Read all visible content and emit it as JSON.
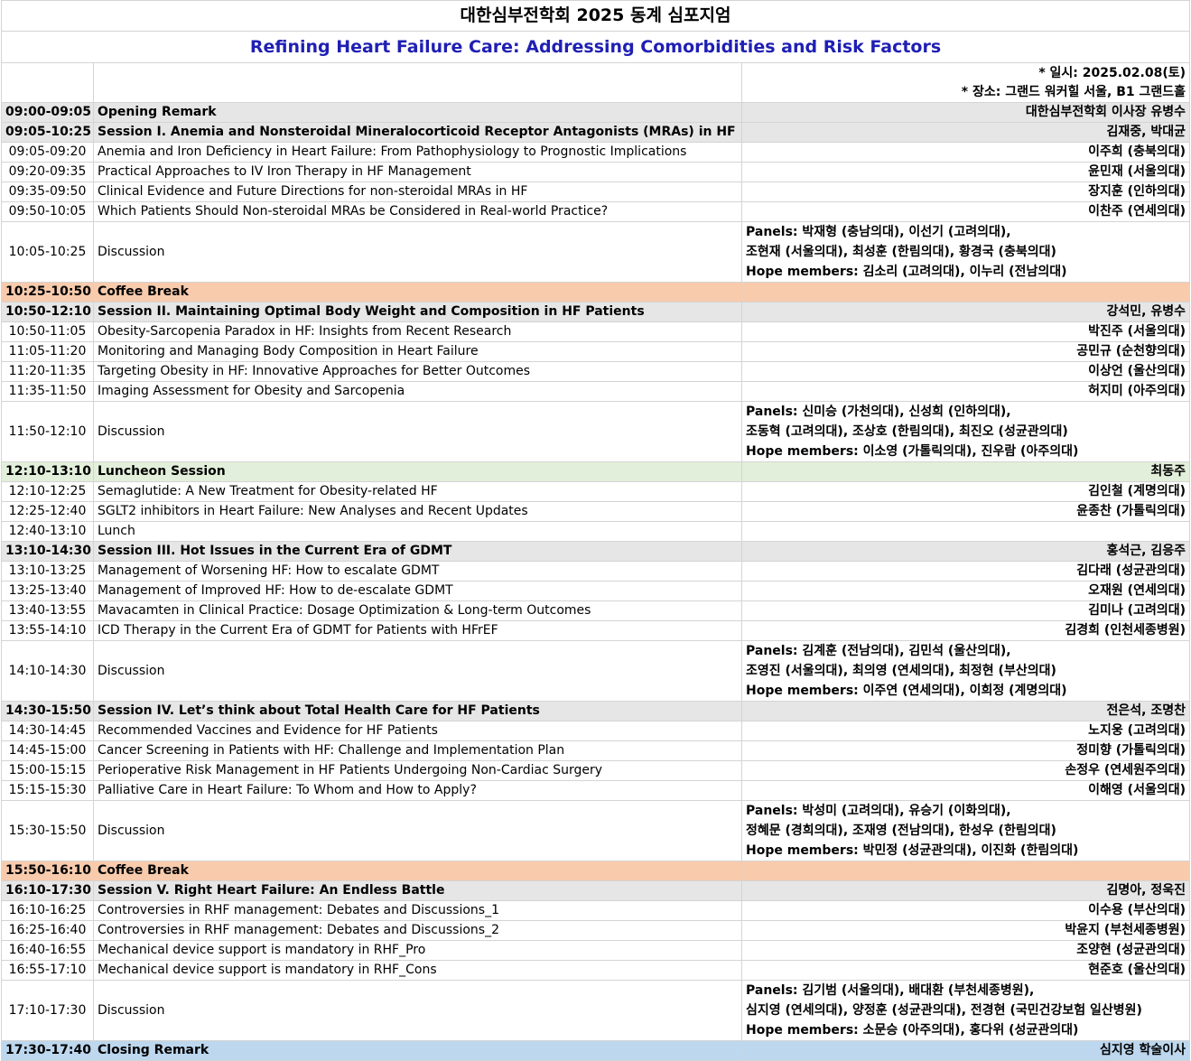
{
  "title": "대한심부전학회 2025 동계 심포지엄",
  "subtitle": "Refining Heart Failure Care: Addressing Comorbidities and Risk Factors",
  "info": {
    "date": "* 일시: 2025.02.08(토)",
    "venue": "* 장소: 그랜드 워커힐 서울, B1 그랜드홀"
  },
  "rows": [
    {
      "type": "section",
      "bg": "gray",
      "time": "09:00-09:05",
      "title": "Opening Remark",
      "speaker": "대한심부전학회 이사장 유병수"
    },
    {
      "type": "section",
      "bg": "gray",
      "time": "09:05-10:25",
      "title": "Session I. Anemia and Nonsteroidal Mineralocorticoid Receptor Antagonists (MRAs) in HF",
      "speaker": "김재중, 박대균"
    },
    {
      "type": "talk",
      "time": "09:05-09:20",
      "title": "Anemia and Iron Deficiency in Heart Failure: From Pathophysiology to Prognostic Implications",
      "speaker": "이주희 (충북의대)"
    },
    {
      "type": "talk",
      "time": "09:20-09:35",
      "title": "Practical Approaches to IV Iron Therapy in HF Management",
      "speaker": "윤민재 (서울의대)"
    },
    {
      "type": "talk",
      "time": "09:35-09:50",
      "title": "Clinical Evidence and Future Directions for non-steroidal MRAs in HF",
      "speaker": "장지훈 (인하의대)"
    },
    {
      "type": "talk",
      "time": "09:50-10:05",
      "title": "Which Patients Should Non-steroidal MRAs be Considered in Real-world Practice?",
      "speaker": "이찬주 (연세의대)"
    },
    {
      "type": "discussion",
      "time": "10:05-10:25",
      "title": "Discussion",
      "lines": [
        "Panels: 박재형 (충남의대), 이선기 (고려의대),",
        "조현재 (서울의대), 최성훈 (한림의대), 황경국 (충북의대)",
        "Hope members: 김소리 (고려의대), 이누리 (전남의대)"
      ]
    },
    {
      "type": "section",
      "bg": "peach",
      "time": "10:25-10:50",
      "title": "Coffee Break",
      "speaker": ""
    },
    {
      "type": "section",
      "bg": "gray",
      "time": "10:50-12:10",
      "title": "Session II. Maintaining Optimal Body Weight and Composition in HF Patients",
      "speaker": "강석민, 유병수"
    },
    {
      "type": "talk",
      "time": "10:50-11:05",
      "title": "Obesity-Sarcopenia Paradox in HF: Insights from Recent Research",
      "speaker": "박진주 (서울의대)"
    },
    {
      "type": "talk",
      "time": "11:05-11:20",
      "title": "Monitoring and Managing Body Composition in Heart Failure",
      "speaker": "공민규 (순천향의대)"
    },
    {
      "type": "talk",
      "time": "11:20-11:35",
      "title": "Targeting Obesity in HF: Innovative Approaches for Better Outcomes",
      "speaker": "이상언 (울산의대)"
    },
    {
      "type": "talk",
      "time": "11:35-11:50",
      "title": "Imaging Assessment for Obesity and Sarcopenia",
      "speaker": "허지미 (아주의대)"
    },
    {
      "type": "discussion",
      "time": "11:50-12:10",
      "title": "Discussion",
      "lines": [
        "Panels: 신미승 (가천의대), 신성희 (인하의대),",
        "조동혁 (고려의대), 조상호 (한림의대), 최진오 (성균관의대)",
        "Hope members: 이소영 (가톨릭의대), 진우람 (아주의대)"
      ]
    },
    {
      "type": "section",
      "bg": "green",
      "time": "12:10-13:10",
      "title": "Luncheon Session",
      "speaker": "최동주"
    },
    {
      "type": "talk",
      "time": "12:10-12:25",
      "title": "Semaglutide: A New Treatment for Obesity-related HF",
      "speaker": "김인철 (계명의대)"
    },
    {
      "type": "talk",
      "time": "12:25-12:40",
      "title": "SGLT2 inhibitors in Heart Failure: New Analyses and Recent Updates",
      "speaker": "윤종찬 (가톨릭의대)"
    },
    {
      "type": "talk",
      "time": "12:40-13:10",
      "title": "Lunch",
      "speaker": ""
    },
    {
      "type": "section",
      "bg": "gray",
      "time": "13:10-14:30",
      "title": "Session III. Hot Issues in the Current Era of GDMT",
      "speaker": "홍석근, 김응주"
    },
    {
      "type": "talk",
      "time": "13:10-13:25",
      "title": "Management of Worsening HF: How to escalate GDMT",
      "speaker": "김다래 (성균관의대)"
    },
    {
      "type": "talk",
      "time": "13:25-13:40",
      "title": "Management of Improved HF: How to de-escalate GDMT",
      "speaker": "오재원 (연세의대)"
    },
    {
      "type": "talk",
      "time": "13:40-13:55",
      "title": "Mavacamten in Clinical Practice: Dosage Optimization & Long-term Outcomes",
      "speaker": "김미나 (고려의대)"
    },
    {
      "type": "talk",
      "time": "13:55-14:10",
      "title": "ICD Therapy in the Current Era of GDMT for Patients with HFrEF",
      "speaker": "김경희 (인천세종병원)"
    },
    {
      "type": "discussion",
      "time": "14:10-14:30",
      "title": "Discussion",
      "lines": [
        "Panels: 김계훈 (전남의대), 김민석 (울산의대),",
        "조영진 (서울의대), 최의영 (연세의대), 최정현 (부산의대)",
        "Hope members: 이주연 (연세의대), 이희정 (계명의대)"
      ]
    },
    {
      "type": "section",
      "bg": "gray",
      "time": "14:30-15:50",
      "title": "Session IV. Let’s think about Total Health Care for HF Patients",
      "speaker": "전은석, 조명찬"
    },
    {
      "type": "talk",
      "time": "14:30-14:45",
      "title": "Recommended Vaccines and Evidence for HF Patients",
      "speaker": "노지웅 (고려의대)"
    },
    {
      "type": "talk",
      "time": "14:45-15:00",
      "title": "Cancer Screening in Patients with HF: Challenge and Implementation Plan",
      "speaker": "정미향 (가톨릭의대)"
    },
    {
      "type": "talk",
      "time": "15:00-15:15",
      "title": "Perioperative Risk Management in HF Patients Undergoing Non-Cardiac Surgery",
      "speaker": "손정우 (연세원주의대)"
    },
    {
      "type": "talk",
      "time": "15:15-15:30",
      "title": "Palliative Care in Heart Failure: To Whom and How to Apply?",
      "speaker": "이해영 (서울의대)"
    },
    {
      "type": "discussion",
      "time": "15:30-15:50",
      "title": "Discussion",
      "lines": [
        "Panels: 박성미 (고려의대), 유승기 (이화의대),",
        "정혜문 (경희의대), 조재영 (전남의대), 한성우 (한림의대)",
        "Hope members: 박민정 (성균관의대), 이진화 (한림의대)"
      ]
    },
    {
      "type": "section",
      "bg": "peach",
      "time": "15:50-16:10",
      "title": "Coffee Break",
      "speaker": ""
    },
    {
      "type": "section",
      "bg": "gray",
      "time": "16:10-17:30",
      "title": "Session V. Right Heart Failure: An Endless Battle",
      "speaker": "김명아, 정욱진"
    },
    {
      "type": "talk",
      "time": "16:10-16:25",
      "title": "Controversies in RHF management: Debates and Discussions_1",
      "speaker": "이수용 (부산의대)"
    },
    {
      "type": "talk",
      "time": "16:25-16:40",
      "title": "Controversies in RHF management: Debates and Discussions_2",
      "speaker": "박윤지 (부천세종병원)"
    },
    {
      "type": "talk",
      "time": "16:40-16:55",
      "title": "Mechanical device support is mandatory in RHF_Pro",
      "speaker": "조양현 (성균관의대)"
    },
    {
      "type": "talk",
      "time": "16:55-17:10",
      "title": "Mechanical device support is mandatory in RHF_Cons",
      "speaker": "현준호 (울산의대)"
    },
    {
      "type": "discussion",
      "time": "17:10-17:30",
      "title": "Discussion",
      "lines": [
        "Panels: 김기범 (서울의대), 배대환 (부천세종병원),",
        "심지영 (연세의대), 양정훈 (성균관의대), 전경현 (국민건강보험 일산병원)",
        "Hope members: 소문승 (아주의대), 홍다위 (성균관의대)"
      ]
    },
    {
      "type": "section",
      "bg": "blue",
      "time": "17:30-17:40",
      "title": "Closing Remark",
      "speaker": "심지영 학술이사"
    }
  ]
}
